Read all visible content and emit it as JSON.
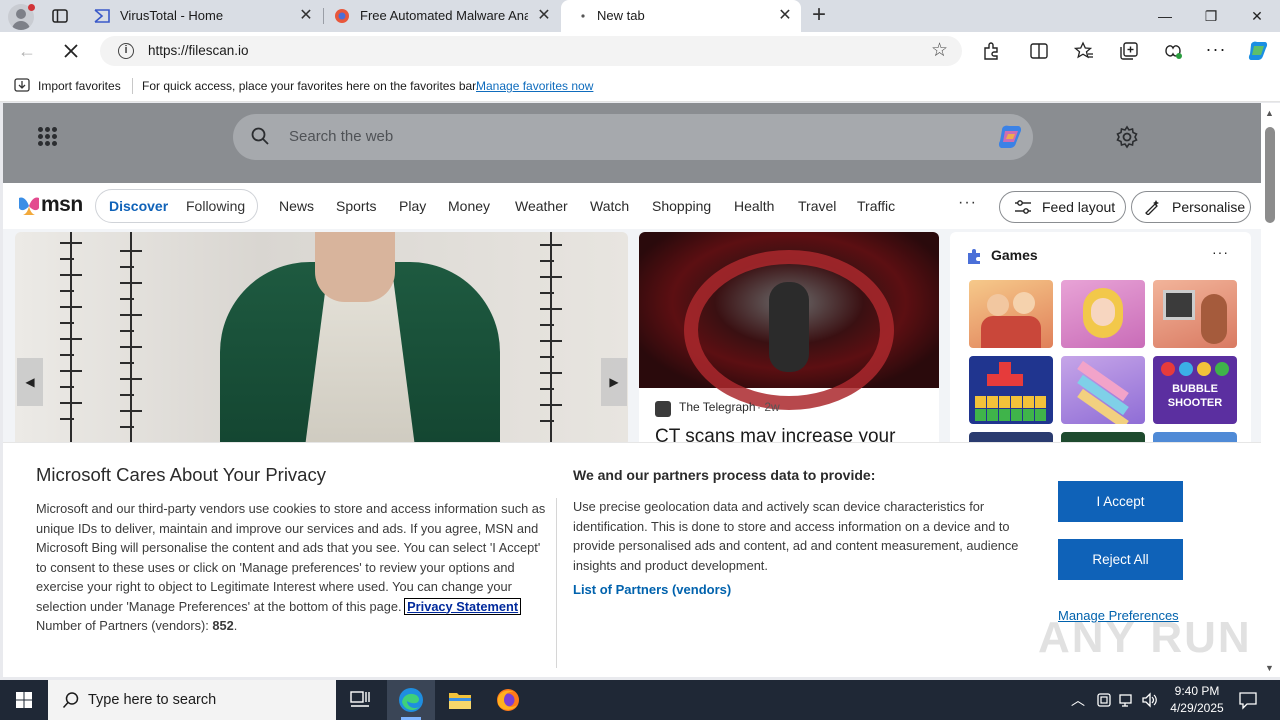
{
  "browser": {
    "tabs": [
      {
        "title": "VirusTotal - Home",
        "close": "✕"
      },
      {
        "title": "Free Automated Malware Analysis Service",
        "close": "✕"
      },
      {
        "title": "New tab",
        "close": "✕"
      }
    ],
    "new_tab": "+",
    "window_controls": {
      "minimize": "—",
      "restore": "❐",
      "close": "✕"
    },
    "address": {
      "url": "https://filescan.io",
      "info": "i"
    },
    "favorites_bar": {
      "import_label": "Import favorites",
      "hint": "For quick access, place your favorites here on the favorites bar.",
      "manage_link": "Manage favorites now"
    }
  },
  "msn": {
    "search_placeholder": "Search the web",
    "logo_text": "msn",
    "pill_tabs": [
      "Discover",
      "Following"
    ],
    "categories": [
      "News",
      "Sports",
      "Play",
      "Money",
      "Weather",
      "Watch",
      "Shopping",
      "Health",
      "Travel",
      "Traffic"
    ],
    "more": "···",
    "feed_layout": "Feed layout",
    "personalise": "Personalise",
    "carousel_prev": "◀",
    "carousel_next": "▶",
    "news_card": {
      "source": "The Telegraph",
      "age": "· 2w",
      "headline": "CT scans may increase your"
    },
    "games": {
      "title": "Games",
      "more": "···",
      "tile_text": "BUBBLE SHOOTER"
    }
  },
  "consent": {
    "title": "Microsoft Cares About Your Privacy",
    "body": "Microsoft and our third-party vendors use cookies to store and access information such as unique IDs to deliver, maintain and improve our services and ads. If you agree, MSN and Microsoft Bing will personalise the content and ads that you see. You can select 'I Accept' to consent to these uses or click on 'Manage preferences' to review your options and exercise your right to object to Legitimate Interest where used.  You can change your selection under 'Manage Preferences' at the bottom of this page.",
    "privacy_link": "Privacy Statement",
    "partners_label": "Number of Partners (vendors):",
    "partners_count": "852",
    "partners_suffix": ".",
    "heading2": "We and our partners process data to provide:",
    "body2": "Use precise geolocation data and actively scan device characteristics for identification. This is done to store and access information on a device and to provide personalised ads and content, ad and content measurement, audience insights and product development.",
    "vendors_link": "List of Partners (vendors)",
    "accept": "I Accept",
    "reject": "Reject All",
    "manage": "Manage Preferences",
    "watermark": "ANY RUN"
  },
  "taskbar": {
    "search_placeholder": "Type here to search",
    "time": "9:40 PM",
    "date": "4/29/2025"
  },
  "colors": {
    "accent": "#0f62b8",
    "link": "#0062ad",
    "taskbar": "#1f2836"
  }
}
